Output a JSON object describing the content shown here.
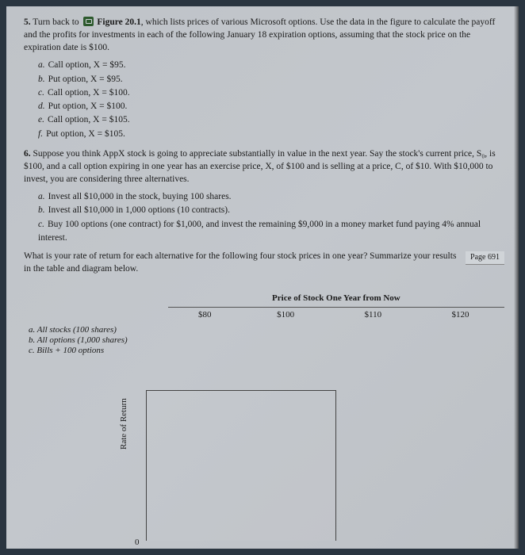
{
  "q5": {
    "num": "5.",
    "text_a": "Turn back to ",
    "fig_ref": "Figure 20.1",
    "text_b": ", which lists prices of various Microsoft options. Use the data in the figure to calculate the payoff and the profits for investments in each of the following January 18 expiration options, assuming that the stock price on the expiration date is $100.",
    "items": [
      {
        "lbl": "a.",
        "txt": "Call option, X = $95."
      },
      {
        "lbl": "b.",
        "txt": "Put option, X = $95."
      },
      {
        "lbl": "c.",
        "txt": "Call option, X = $100."
      },
      {
        "lbl": "d.",
        "txt": "Put option, X = $100."
      },
      {
        "lbl": "e.",
        "txt": "Call option, X = $105."
      },
      {
        "lbl": "f.",
        "txt": "Put option, X = $105."
      }
    ]
  },
  "q6": {
    "num": "6.",
    "text": "Suppose you think AppX stock is going to appreciate substantially in value in the next year. Say the stock's current price, S₀, is $100, and a call option expiring in one year has an exercise price, X, of $100 and is selling at a price, C, of $10. With $10,000 to invest, you are considering three alternatives.",
    "items": [
      {
        "lbl": "a.",
        "txt": "Invest all $10,000 in the stock, buying 100 shares."
      },
      {
        "lbl": "b.",
        "txt": "Invest all $10,000 in 1,000 options (10 contracts)."
      },
      {
        "lbl": "c.",
        "txt": "Buy 100 options (one contract) for $1,000, and invest the remaining $9,000 in a money market fund paying 4% annual interest."
      }
    ],
    "prompt": "What is your rate of return for each alternative for the following four stock prices in one year? Summarize your results in the table and diagram below.",
    "page_tag": "Page 691"
  },
  "table": {
    "group_head": "Price of Stock One Year from Now",
    "cols": [
      "$80",
      "$100",
      "$110",
      "$120"
    ],
    "rows": [
      "a. All stocks (100 shares)",
      "b. All options (1,000 shares)",
      "c. Bills + 100 options"
    ]
  },
  "chart_data": {
    "type": "line",
    "title": "",
    "xlabel": "",
    "ylabel": "Rate of Return",
    "x": [
      80,
      100,
      110,
      120
    ],
    "series": [],
    "ylim": [
      0,
      null
    ],
    "note": "Blank diagram region — axes only, no plotted data visible"
  },
  "chart_zero": "0"
}
